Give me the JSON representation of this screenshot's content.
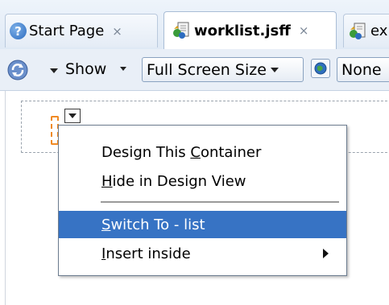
{
  "tabs": [
    {
      "label": "Start Page",
      "close": "×",
      "icon": "help-icon"
    },
    {
      "label": "worklist.jsff",
      "close": "×",
      "icon": "jsf-file-icon",
      "active": true
    },
    {
      "label": "ex",
      "icon": "jsf-file-icon"
    }
  ],
  "toolbar": {
    "refresh_icon": "refresh-icon",
    "show_label": "Show",
    "screen_size": "Full Screen Size",
    "globe_icon": "globe-icon",
    "locale": "None"
  },
  "context_menu": {
    "items": [
      {
        "label": "Design This Container",
        "mnemonic": "C"
      },
      {
        "label": "Hide in Design View",
        "mnemonic": "H"
      },
      {
        "label": "Switch To - list",
        "mnemonic": "S",
        "selected": true
      },
      {
        "label": "Insert inside",
        "mnemonic": "I",
        "submenu": true
      }
    ]
  },
  "colors": {
    "selection": "#3773c4",
    "tabbar_bg": "#dfe9f5",
    "container_marker": "#f08a24"
  }
}
